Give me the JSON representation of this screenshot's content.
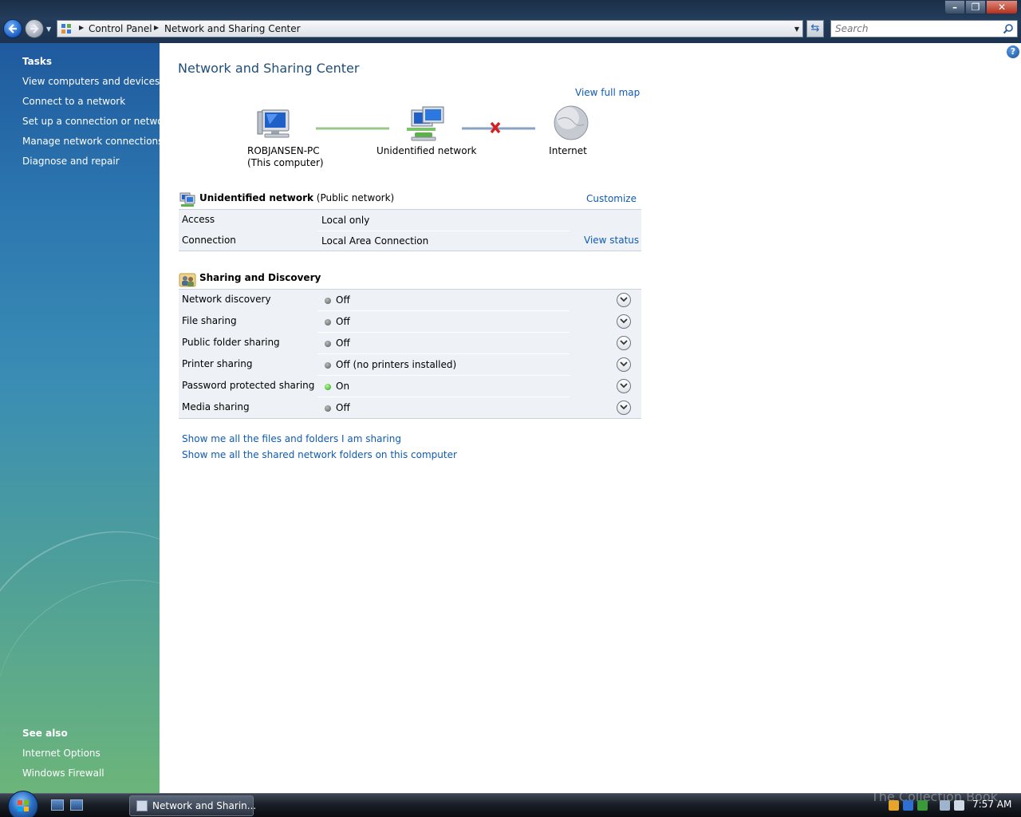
{
  "window": {
    "breadcrumbs": [
      "Control Panel",
      "Network and Sharing Center"
    ],
    "search_placeholder": "Search"
  },
  "sidebar": {
    "tasks_heading": "Tasks",
    "tasks": [
      {
        "label": "View computers and devices"
      },
      {
        "label": "Connect to a network"
      },
      {
        "label": "Set up a connection or network"
      },
      {
        "label": "Manage network connections"
      },
      {
        "label": "Diagnose and repair"
      }
    ],
    "see_also_heading": "See also",
    "see_also": [
      {
        "label": "Internet Options"
      },
      {
        "label": "Windows Firewall"
      }
    ]
  },
  "main": {
    "title": "Network and Sharing Center",
    "view_full_map": "View full map",
    "map": {
      "computer_name": "ROBJANSEN-PC",
      "computer_sub": "(This computer)",
      "network": "Unidentified network",
      "internet": "Internet"
    },
    "network_section": {
      "name": "Unidentified network",
      "type": "(Public network)",
      "customize": "Customize",
      "rows": [
        {
          "label": "Access",
          "value": "Local only"
        },
        {
          "label": "Connection",
          "value": "Local Area Connection",
          "action": "View status"
        }
      ]
    },
    "sharing_section": {
      "title": "Sharing and Discovery",
      "rows": [
        {
          "label": "Network discovery",
          "status": "Off",
          "state": "off"
        },
        {
          "label": "File sharing",
          "status": "Off",
          "state": "off"
        },
        {
          "label": "Public folder sharing",
          "status": "Off",
          "state": "off"
        },
        {
          "label": "Printer sharing",
          "status": "Off (no printers installed)",
          "state": "off"
        },
        {
          "label": "Password protected sharing",
          "status": "On",
          "state": "on"
        },
        {
          "label": "Media sharing",
          "status": "Off",
          "state": "off"
        }
      ]
    },
    "links": [
      "Show me all the files and folders I am sharing",
      "Show me all the shared network folders on this computer"
    ]
  },
  "taskbar": {
    "task_button": "Network and Sharin...",
    "clock": "7:57 AM",
    "watermark": "The Collection Book"
  },
  "colors": {
    "link": "#0e5bb3",
    "title": "#1e4e79",
    "status_on": "#1f9a1f",
    "status_off": "#555555",
    "disconnected_x": "#d42020"
  }
}
